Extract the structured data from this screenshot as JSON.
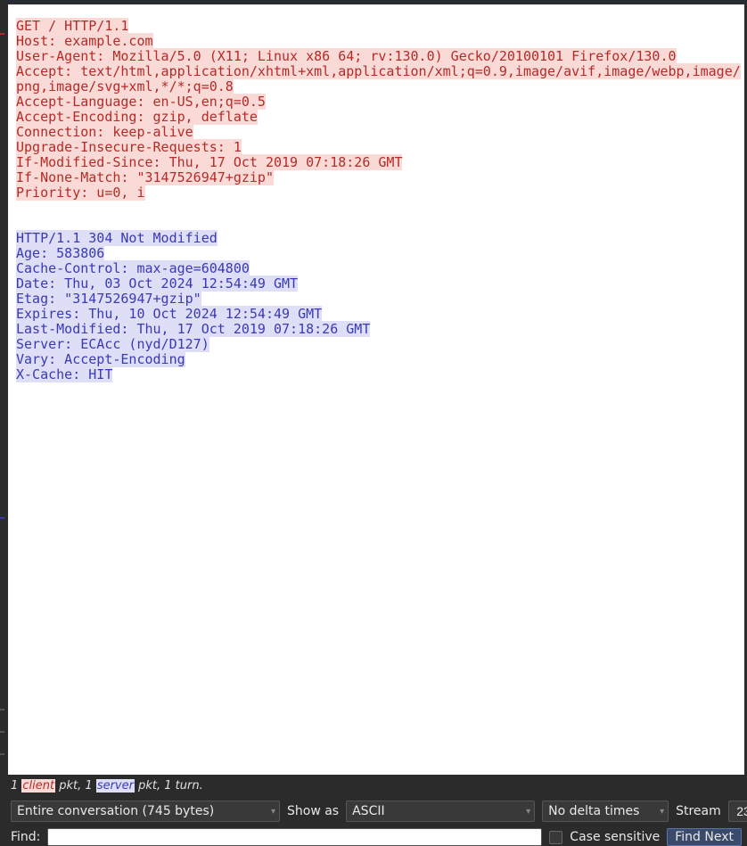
{
  "request_lines": [
    "GET / HTTP/1.1",
    "Host: example.com",
    "User-Agent: Mozilla/5.0 (X11; Linux x86_64; rv:130.0) Gecko/20100101 Firefox/130.0",
    "Accept: text/html,application/xhtml+xml,application/xml;q=0.9,image/avif,image/webp,image/png,image/svg+xml,*/*;q=0.8",
    "Accept-Language: en-US,en;q=0.5",
    "Accept-Encoding: gzip, deflate",
    "Connection: keep-alive",
    "Upgrade-Insecure-Requests: 1",
    "If-Modified-Since: Thu, 17 Oct 2019 07:18:26 GMT",
    "If-None-Match: \"3147526947+gzip\"",
    "Priority: u=0, i"
  ],
  "response_lines": [
    "HTTP/1.1 304 Not Modified",
    "Age: 583806",
    "Cache-Control: max-age=604800",
    "Date: Thu, 03 Oct 2024 12:54:49 GMT",
    "Etag: \"3147526947+gzip\"",
    "Expires: Thu, 10 Oct 2024 12:54:49 GMT",
    "Last-Modified: Thu, 17 Oct 2019 07:18:26 GMT",
    "Server: ECAcc (nyd/D127)",
    "Vary: Accept-Encoding",
    "X-Cache: HIT"
  ],
  "summary": {
    "prefix1": "1 ",
    "client": "client",
    "mid": " pkt, 1 ",
    "server": "server",
    "suffix": " pkt, 1 turn."
  },
  "controls": {
    "conversation": "Entire conversation (745 bytes)",
    "show_as_label": "Show as",
    "show_as_value": "ASCII",
    "delta_value": "No delta times",
    "stream_label": "Stream",
    "stream_value": "23"
  },
  "find": {
    "label": "Find:",
    "value": "",
    "case_label": "Case sensitive",
    "button": "Find Next"
  }
}
